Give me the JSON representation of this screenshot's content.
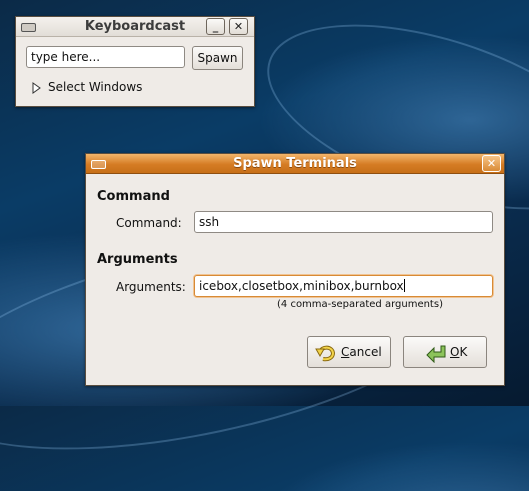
{
  "keyboardcast": {
    "title": "Keyboardcast",
    "minimize_glyph": "_",
    "close_glyph": "✕",
    "input_value": "type here...",
    "spawn_label": "Spawn",
    "expander_icon": "triangle-right-icon",
    "select_windows_label": "Select Windows"
  },
  "spawn": {
    "title": "Spawn Terminals",
    "close_glyph": "✕",
    "command_section": "Command",
    "command_label": "Command:",
    "command_value": "ssh",
    "arguments_section": "Arguments",
    "arguments_label": "Arguments:",
    "arguments_value": "icebox,closetbox,minibox,burnbox",
    "arguments_hint": "(4 comma-separated arguments)",
    "cancel_label": "Cancel",
    "cancel_icon": "undo-arrow-icon",
    "ok_label": "OK",
    "ok_icon": "check-arrow-icon"
  },
  "colors": {
    "active_titlebar": "#d57c24",
    "window_bg": "#efebe7",
    "focus_border": "#d88a35",
    "desktop": "#0a3c66"
  }
}
